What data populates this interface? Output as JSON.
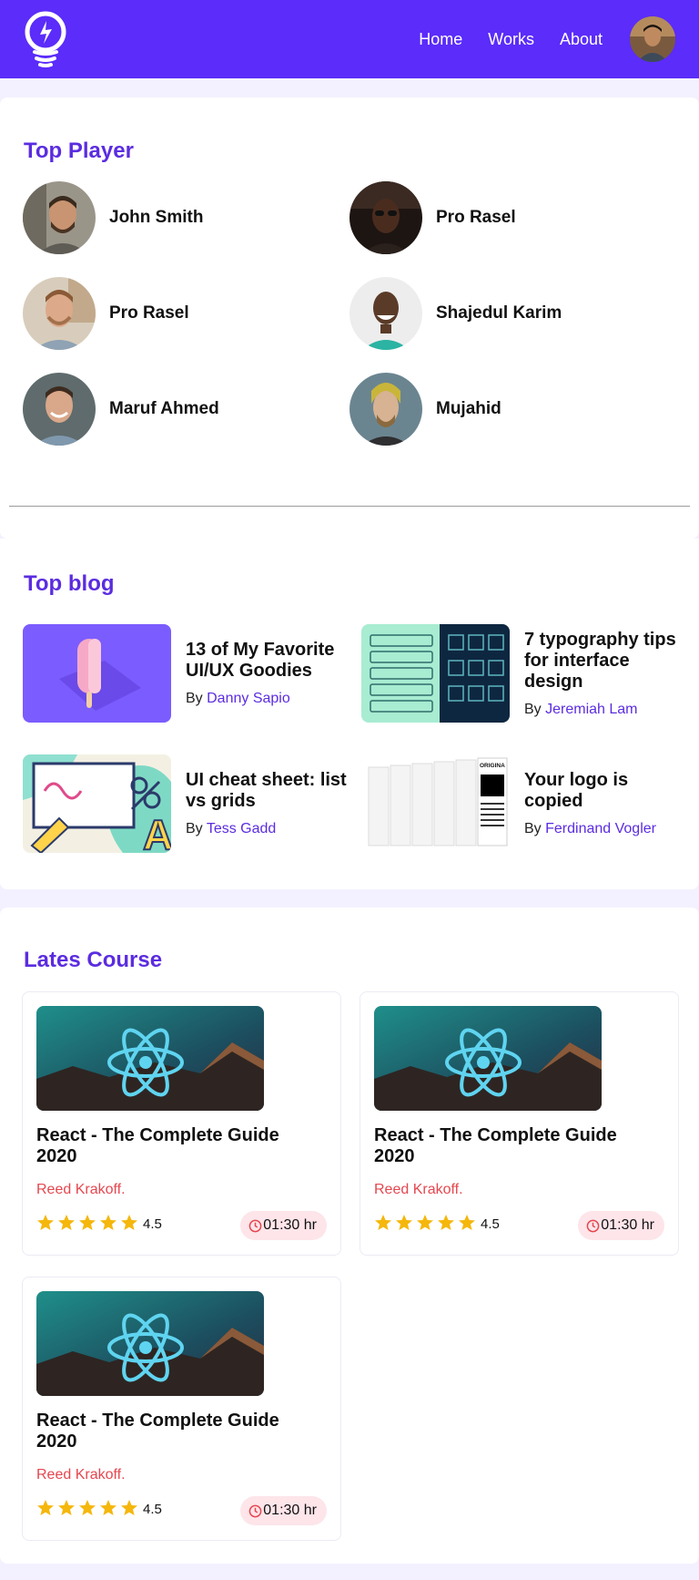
{
  "nav": {
    "links": [
      "Home",
      "Works",
      "About"
    ]
  },
  "top_player": {
    "title": "Top Player",
    "players": [
      {
        "name": "John Smith"
      },
      {
        "name": "Pro Rasel"
      },
      {
        "name": "Pro Rasel"
      },
      {
        "name": "Shajedul Karim"
      },
      {
        "name": "Maruf Ahmed"
      },
      {
        "name": "Mujahid"
      }
    ]
  },
  "top_blog": {
    "title": "Top blog",
    "by_label": "By",
    "posts": [
      {
        "title": "13 of My Favorite UI/UX Goodies",
        "author": "Danny Sapio"
      },
      {
        "title": "7 typography tips for interface design",
        "author": "Jeremiah Lam"
      },
      {
        "title": "UI cheat sheet: list vs grids",
        "author": "Tess Gadd"
      },
      {
        "title": "Your logo is copied",
        "author": "Ferdinand Vogler"
      }
    ]
  },
  "latest_course": {
    "title": "Lates Course",
    "courses": [
      {
        "title": "React - The Complete Guide 2020",
        "author": "Reed Krakoff.",
        "rating": "4.5",
        "stars": 5,
        "duration": "01:30 hr"
      },
      {
        "title": "React - The Complete Guide 2020",
        "author": "Reed Krakoff.",
        "rating": "4.5",
        "stars": 5,
        "duration": "01:30 hr"
      },
      {
        "title": "React - The Complete Guide 2020",
        "author": "Reed Krakoff.",
        "rating": "4.5",
        "stars": 5,
        "duration": "01:30 hr"
      }
    ]
  },
  "colors": {
    "brand": "#5b2cfa",
    "accent_text": "#5b2ce0",
    "author_red": "#e5474f",
    "star": "#f5b70c",
    "pill_bg": "#fde5ea"
  },
  "logo_lettering": "ORIGINAL"
}
